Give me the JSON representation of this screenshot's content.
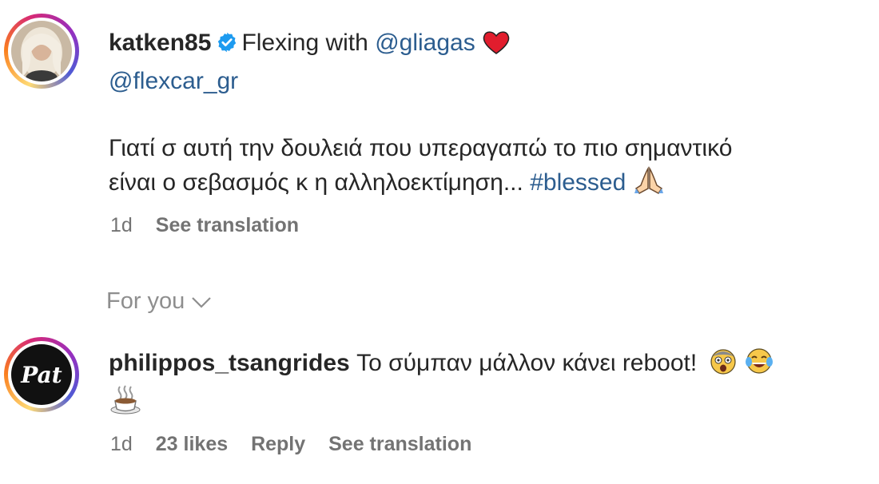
{
  "post": {
    "username": "katken85",
    "caption_text": "Flexing with",
    "mention_1": "@gliagas",
    "mention_2": "@flexcar_gr",
    "body_line_1": "Γιατί σ αυτή την δουλειά που υπεραγαπώ το πιο σημαντικό",
    "body_line_2": "είναι ο σεβασμός κ η αλληλοεκτίμηση...",
    "hashtag": "#blessed",
    "time": "1d",
    "see_translation": "See translation"
  },
  "section": {
    "for_you_label": "For you"
  },
  "comment": {
    "username": "philippos_tsangrides",
    "text": "Το σύμπαν μάλλον κάνει reboot!",
    "avatar_text": "Pat",
    "time": "1d",
    "likes": "23 likes",
    "reply": "Reply",
    "see_translation": "See translation"
  },
  "colors": {
    "link": "#2c5d8f",
    "meta": "#737373",
    "verified": "#1d9bf0",
    "heart": "#e11d2d"
  },
  "icons": [
    "verified-badge-icon",
    "red-heart-icon",
    "folded-hands-icon",
    "chevron-down-icon",
    "shocked-face-emoji",
    "tears-of-joy-emoji",
    "hot-beverage-emoji"
  ]
}
